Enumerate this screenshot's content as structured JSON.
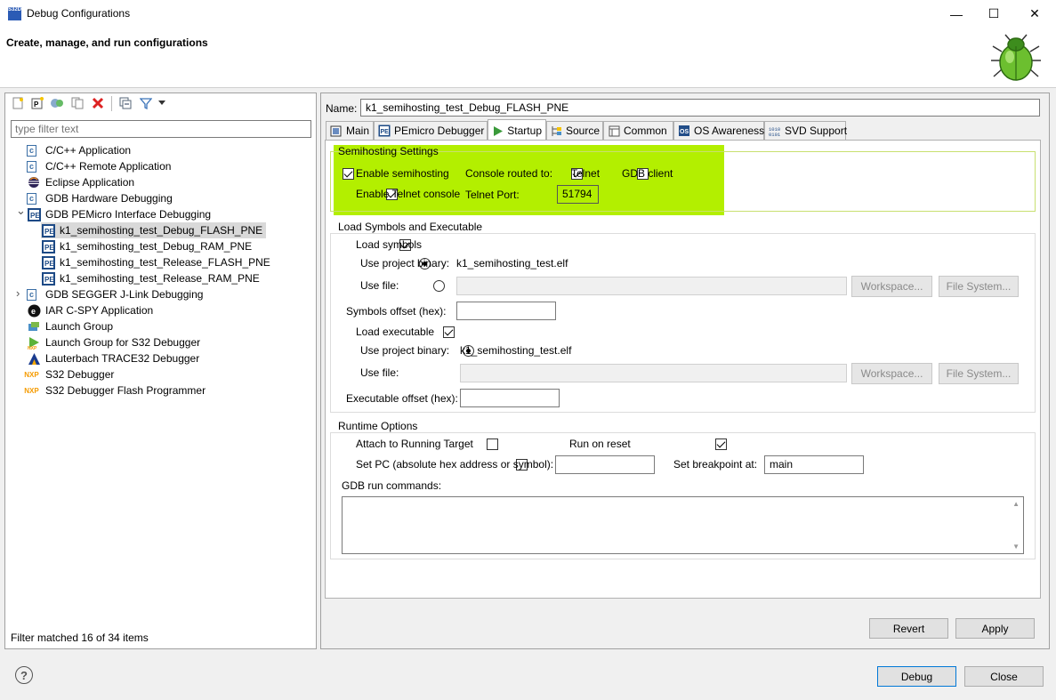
{
  "window": {
    "title": "Debug Configurations",
    "app_icon_text": "S32DS",
    "minimize": "—",
    "maximize": "☐",
    "close": "✕"
  },
  "banner": {
    "title": "Create, manage, and run configurations"
  },
  "filter": {
    "placeholder": "type filter text",
    "status": "Filter matched 16 of 34 items"
  },
  "tree": [
    {
      "label": "C/C++ Application",
      "icon": "c-app-icon",
      "indent": 0
    },
    {
      "label": "C/C++ Remote Application",
      "icon": "c-app-icon",
      "indent": 0
    },
    {
      "label": "Eclipse Application",
      "icon": "eclipse-icon",
      "indent": 0
    },
    {
      "label": "GDB Hardware Debugging",
      "icon": "c-app-icon",
      "indent": 0
    },
    {
      "label": "GDB PEMicro Interface Debugging",
      "icon": "pemicro-icon",
      "indent": 0,
      "expanded": true
    },
    {
      "label": "k1_semihosting_test_Debug_FLASH_PNE",
      "icon": "pemicro-icon",
      "indent": 1,
      "selected": true
    },
    {
      "label": "k1_semihosting_test_Debug_RAM_PNE",
      "icon": "pemicro-icon",
      "indent": 1
    },
    {
      "label": "k1_semihosting_test_Release_FLASH_PNE",
      "icon": "pemicro-icon",
      "indent": 1
    },
    {
      "label": "k1_semihosting_test_Release_RAM_PNE",
      "icon": "pemicro-icon",
      "indent": 1
    },
    {
      "label": "GDB SEGGER J-Link Debugging",
      "icon": "c-app-icon",
      "indent": 0,
      "collapsed": true
    },
    {
      "label": "IAR C-SPY Application",
      "icon": "iar-icon",
      "indent": 0
    },
    {
      "label": "Launch Group",
      "icon": "launch-group-icon",
      "indent": 0
    },
    {
      "label": "Launch Group for S32 Debugger",
      "icon": "launch-group-s32-icon",
      "indent": 0
    },
    {
      "label": "Lauterbach TRACE32 Debugger",
      "icon": "lauterbach-icon",
      "indent": 0
    },
    {
      "label": "S32 Debugger",
      "icon": "nxp-icon",
      "indent": 0
    },
    {
      "label": "S32 Debugger Flash Programmer",
      "icon": "nxp-icon",
      "indent": 0
    }
  ],
  "config": {
    "name_label": "Name:",
    "name_value": "k1_semihosting_test_Debug_FLASH_PNE"
  },
  "tabs": [
    {
      "label": "Main",
      "icon": "main-tab-icon"
    },
    {
      "label": "PEmicro Debugger",
      "icon": "pemicro-icon"
    },
    {
      "label": "Startup",
      "icon": "startup-play-icon",
      "active": true
    },
    {
      "label": "Source",
      "icon": "source-icon"
    },
    {
      "label": "Common",
      "icon": "common-icon"
    },
    {
      "label": "OS Awareness",
      "icon": "os-awareness-icon"
    },
    {
      "label": "SVD Support",
      "icon": "svd-icon"
    }
  ],
  "semihosting": {
    "group_label": "Semihosting Settings",
    "enable_semihosting": "Enable semihosting",
    "enable_telnet_console": "Enable Telnet console",
    "console_routed_to": "Console routed to:",
    "telnet": "Telnet",
    "gdb_client": "GDB client",
    "telnet_port_label": "Telnet Port:",
    "telnet_port": "51794",
    "highlight_color": "#b3ef00"
  },
  "load": {
    "group_label": "Load Symbols and Executable",
    "load_symbols": "Load symbols",
    "use_project_binary": "Use project binary:",
    "binary_name": "k1_semihosting_test.elf",
    "use_file": "Use file:",
    "workspace_btn": "Workspace...",
    "filesystem_btn": "File System...",
    "symbols_offset": "Symbols offset (hex):",
    "load_executable": "Load executable",
    "executable_offset": "Executable offset (hex):"
  },
  "runtime": {
    "group_label": "Runtime Options",
    "attach": "Attach to Running Target",
    "run_on_reset": "Run on reset",
    "set_pc": "Set PC (absolute hex address or symbol):",
    "set_breakpoint": "Set breakpoint at:",
    "breakpoint_value": "main",
    "gdb_run_commands": "GDB run commands:"
  },
  "buttons": {
    "revert": "Revert",
    "apply": "Apply",
    "debug": "Debug",
    "close": "Close",
    "help": "?"
  }
}
